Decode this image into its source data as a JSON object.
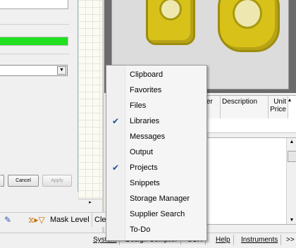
{
  "dialog": {
    "progress_fraction": 1.0,
    "progress_color": "#20e020",
    "buttons": {
      "ok": "",
      "cancel": "Cancel",
      "apply": "Apply"
    }
  },
  "filter_bar": {
    "mask_label": "Mask Level",
    "clear_label": "Clea"
  },
  "grid": {
    "columns": [
      "er",
      "Description",
      "Unit Price"
    ]
  },
  "statusbar": {
    "tabs": [
      "System",
      "Design Compiler",
      "SCH",
      "Help",
      "Instruments",
      ">>"
    ]
  },
  "context_menu": {
    "items": [
      {
        "label": "Clipboard",
        "checked": false
      },
      {
        "label": "Favorites",
        "checked": false
      },
      {
        "label": "Files",
        "checked": false
      },
      {
        "label": "Libraries",
        "checked": true
      },
      {
        "label": "Messages",
        "checked": false
      },
      {
        "label": "Output",
        "checked": false
      },
      {
        "label": "Projects",
        "checked": true
      },
      {
        "label": "Snippets",
        "checked": false
      },
      {
        "label": "Storage Manager",
        "checked": false
      },
      {
        "label": "Supplier Search",
        "checked": false
      },
      {
        "label": "To-Do",
        "checked": false
      }
    ]
  },
  "colors": {
    "pad_fill": "#d8c21a",
    "check_color": "#1a4f9c"
  }
}
